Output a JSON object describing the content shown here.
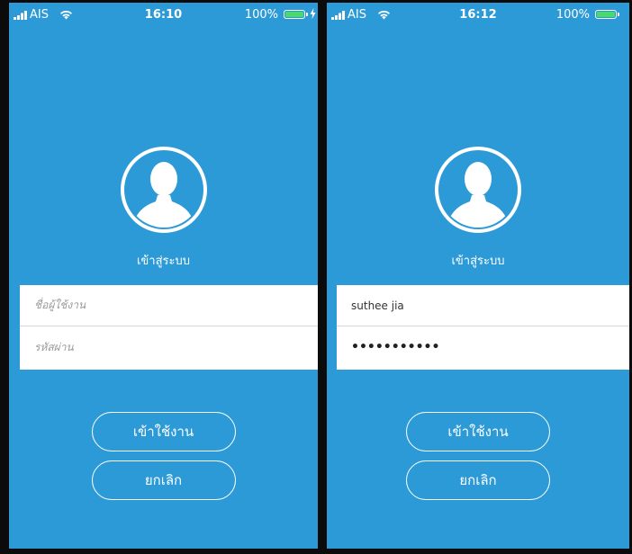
{
  "screens": [
    {
      "status": {
        "carrier": "AIS",
        "time": "16:10",
        "battery": "100%"
      },
      "title": "เข้าสู่ระบบ",
      "username": {
        "value": "",
        "placeholder": "ชื่อผู้ใช้งาน"
      },
      "password": {
        "value": "",
        "placeholder": "รหัสผ่าน"
      },
      "login_button": "เข้าใช้งาน",
      "cancel_button": "ยกเลิก"
    },
    {
      "status": {
        "carrier": "AIS",
        "time": "16:12",
        "battery": "100%"
      },
      "title": "เข้าสู่ระบบ",
      "username": {
        "value": "suthee jia",
        "placeholder": ""
      },
      "password": {
        "value": "•••••••••••",
        "placeholder": ""
      },
      "login_button": "เข้าใช้งาน",
      "cancel_button": "ยกเลิก"
    }
  ],
  "colors": {
    "background": "#2d9ad8",
    "battery_fill": "#4cd964",
    "text_on_blue": "#ffffff"
  },
  "icons": [
    "signal-icon",
    "wifi-icon",
    "battery-icon",
    "charging-bolt-icon",
    "user-avatar-icon"
  ]
}
